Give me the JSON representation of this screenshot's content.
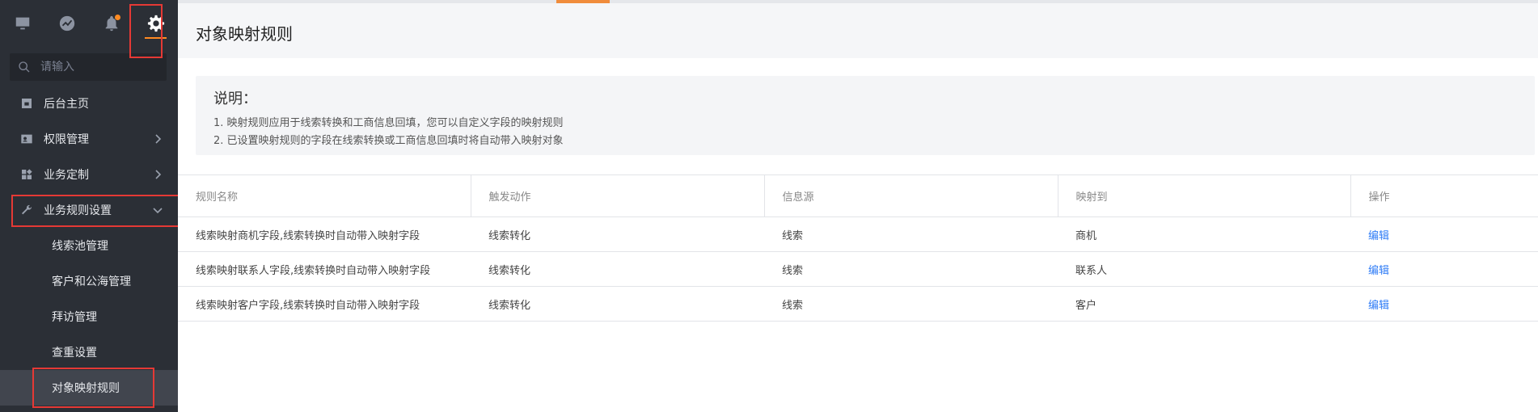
{
  "sidebar": {
    "top_icons": [
      {
        "name": "monitor-icon"
      },
      {
        "name": "dashboard-icon"
      },
      {
        "name": "bell-icon"
      },
      {
        "name": "gear-icon"
      }
    ],
    "search_placeholder": "请输入",
    "items": [
      {
        "label": "后台主页",
        "icon": "home-icon"
      },
      {
        "label": "权限管理",
        "icon": "id-card-icon"
      },
      {
        "label": "业务定制",
        "icon": "widgets-icon"
      },
      {
        "label": "业务规则设置",
        "icon": "wrench-icon"
      }
    ],
    "sub_items": [
      {
        "label": "线索池管理"
      },
      {
        "label": "客户和公海管理"
      },
      {
        "label": "拜访管理"
      },
      {
        "label": "查重设置"
      },
      {
        "label": "对象映射规则"
      }
    ]
  },
  "main": {
    "title": "对象映射规则",
    "info": {
      "title": "说明：",
      "lines": [
        "1. 映射规则应用于线索转换和工商信息回填，您可以自定义字段的映射规则",
        "2. 已设置映射规则的字段在线索转换或工商信息回填时将自动带入映射对象"
      ]
    },
    "table": {
      "headers": [
        "规则名称",
        "触发动作",
        "信息源",
        "映射到",
        "操作"
      ],
      "rows": [
        [
          "线索映射商机字段,线索转换时自动带入映射字段",
          "线索转化",
          "线索",
          "商机",
          "编辑"
        ],
        [
          "线索映射联系人字段,线索转换时自动带入映射字段",
          "线索转化",
          "线索",
          "联系人",
          "编辑"
        ],
        [
          "线索映射客户字段,线索转换时自动带入映射字段",
          "线索转化",
          "线索",
          "客户",
          "编辑"
        ]
      ]
    }
  },
  "colors": {
    "sidebar_bg": "#2b2f36",
    "accent_orange": "#ff8a22",
    "highlight_red": "#e53935",
    "link_blue": "#2f7cf6"
  }
}
